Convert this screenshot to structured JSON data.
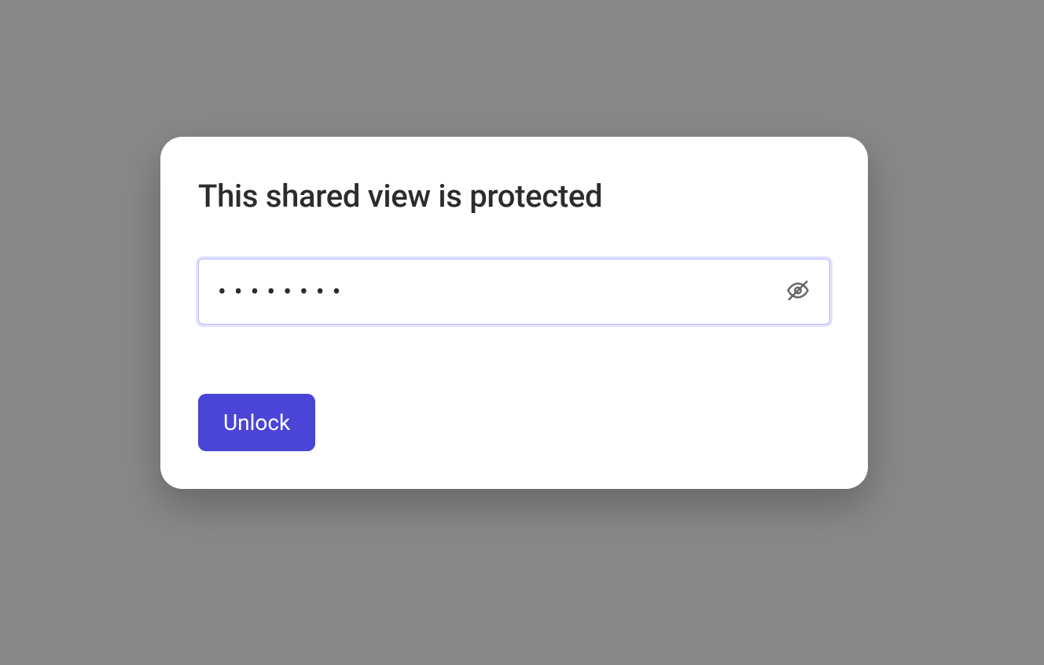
{
  "modal": {
    "title": "This shared view is protected",
    "password_value": "••••••••",
    "password_placeholder": "",
    "unlock_label": "Unlock"
  },
  "colors": {
    "primary": "#4a45d6",
    "background": "#888888",
    "modal_bg": "#ffffff",
    "text": "#2c2c2c",
    "border_focus": "#b5b5ff"
  }
}
